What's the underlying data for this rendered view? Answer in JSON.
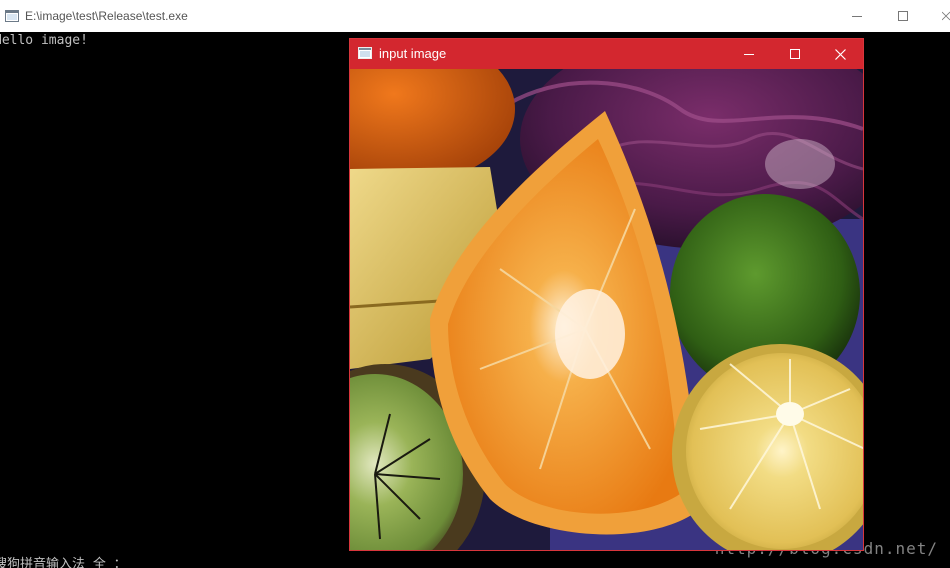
{
  "console": {
    "title": "E:\\image\\test\\Release\\test.exe",
    "lines": [
      "Hello image!",
      "搜狗拼音输入法 全 ："
    ]
  },
  "image_window": {
    "title": "input image",
    "image_description_icon": "fruit-photo"
  },
  "watermark": "http://blog.csdn.net/",
  "colors": {
    "console_bg": "#000000",
    "titlebar_bg": "#ffffff",
    "image_titlebar_bg": "#d3272f",
    "console_text": "#c0c0c0"
  }
}
